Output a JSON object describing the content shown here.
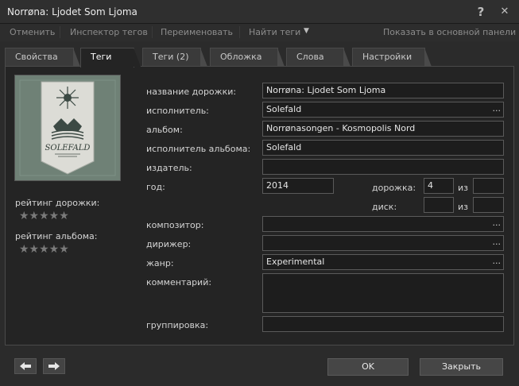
{
  "window": {
    "title": "Norrøna: Ljodet Som Ljoma",
    "help_glyph": "?",
    "close_glyph": "✕"
  },
  "toolbar": {
    "undo": "Отменить",
    "inspector": "Инспектор тегов",
    "rename": "Переименовать",
    "find_tags": "Найти теги",
    "show_main": "Показать в основной панели"
  },
  "tabs": [
    "Свойства",
    "Теги",
    "Теги (2)",
    "Обложка",
    "Слова",
    "Настройки"
  ],
  "left": {
    "track_rating_label": "рейтинг дорожки:",
    "album_rating_label": "рейтинг альбома:",
    "stars": "★★★★★",
    "track_rating": 0,
    "album_rating": 0
  },
  "fields": {
    "title_label": "название дорожки:",
    "title_value": "Norrøna: Ljodet Som Ljoma",
    "artist_label": "исполнитель:",
    "artist_value": "Solefald",
    "album_label": "альбом:",
    "album_value": "Norrønasongen - Kosmopolis Nord",
    "album_artist_label": "исполнитель альбома:",
    "album_artist_value": "Solefald",
    "publisher_label": "издатель:",
    "publisher_value": "",
    "year_label": "год:",
    "year_value": "2014",
    "track_label": "дорожка:",
    "track_value": "4",
    "of_label": "из",
    "track_total": "",
    "disc_label": "диск:",
    "disc_value": "",
    "disc_total": "",
    "composer_label": "композитор:",
    "composer_value": "",
    "conductor_label": "дирижер:",
    "conductor_value": "",
    "genre_label": "жанр:",
    "genre_value": "Experimental",
    "comment_label": "комментарий:",
    "comment_value": "",
    "grouping_label": "группировка:",
    "grouping_value": "",
    "ellipsis": "..."
  },
  "buttons": {
    "ok": "OK",
    "close": "Закрыть"
  },
  "art": {
    "band_logo_text": "SOLEFALD"
  }
}
